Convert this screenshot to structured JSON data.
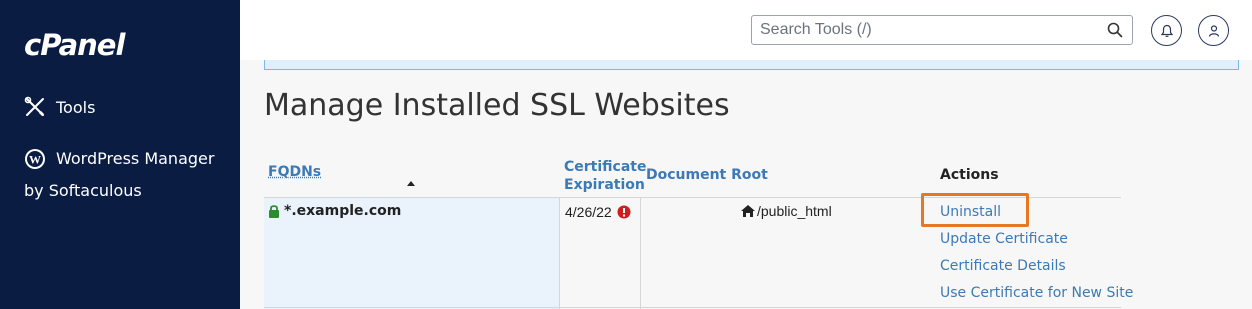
{
  "sidebar": {
    "logo": "cPanel",
    "items": [
      {
        "label": "Tools",
        "icon": "tools-icon"
      },
      {
        "label": "WordPress Manager",
        "label2": "by Softaculous",
        "icon": "wordpress-icon"
      }
    ]
  },
  "header": {
    "search_placeholder": "Search Tools (/)",
    "notifications_icon": "bell-icon",
    "user_icon": "user-icon"
  },
  "page": {
    "title": "Manage Installed SSL Websites"
  },
  "table": {
    "headers": {
      "fqdns": "FQDNs",
      "expiration_line1": "Certificate",
      "expiration_line2": "Expiration",
      "document_root": "Document Root",
      "actions": "Actions"
    },
    "rows": [
      {
        "fqdn": "*.example.com",
        "expiration": "4/26/22",
        "document_root": "/public_html",
        "actions": [
          "Uninstall",
          "Update Certificate",
          "Certificate Details",
          "Use Certificate for New Site"
        ]
      }
    ]
  },
  "colors": {
    "sidebar_bg": "#0b1c43",
    "link": "#3b7ab7",
    "highlight": "#e87722",
    "row_bg": "#eaf2fc",
    "warning": "#cc1f1f",
    "lock": "#2e8b2e"
  }
}
